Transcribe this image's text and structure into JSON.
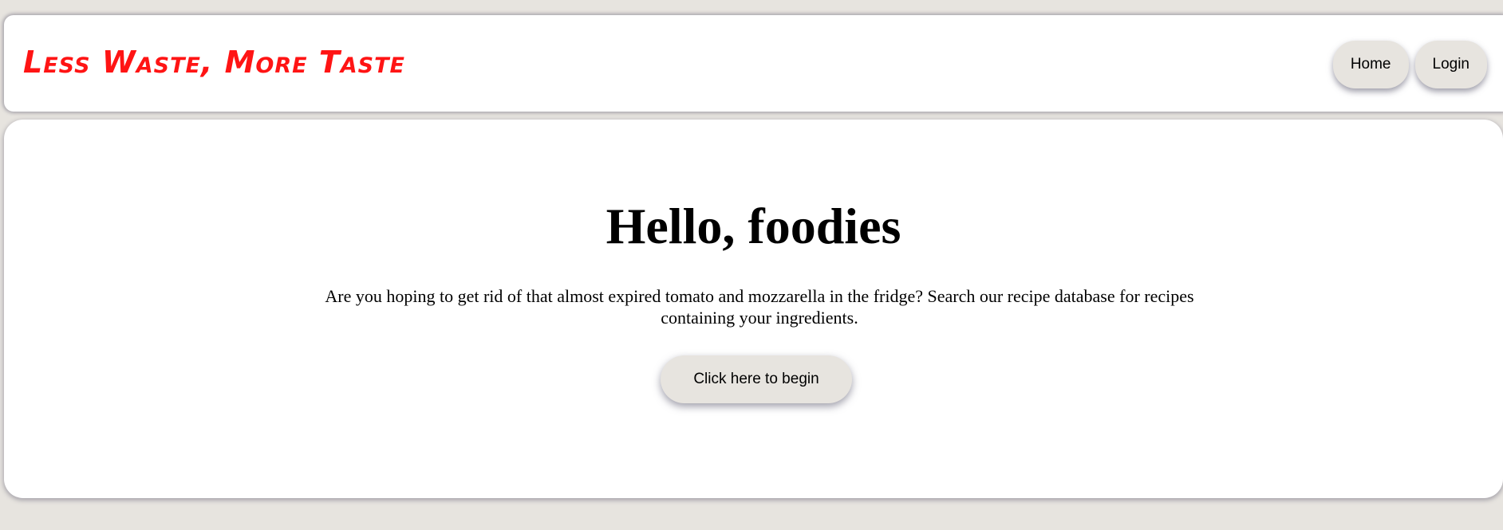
{
  "header": {
    "brand": "Less Waste, More Taste",
    "nav": {
      "home_label": "Home",
      "login_label": "Login"
    }
  },
  "hero": {
    "title": "Hello, foodies",
    "description": "Are you hoping to get rid of that almost expired tomato and mozzarella in the fridge? Search our recipe database for recipes containing your ingredients.",
    "cta_label": "Click here to begin"
  },
  "colors": {
    "brand": "#ff1414",
    "background": "#e7e4df",
    "card": "#ffffff",
    "button": "#e7e4df"
  }
}
